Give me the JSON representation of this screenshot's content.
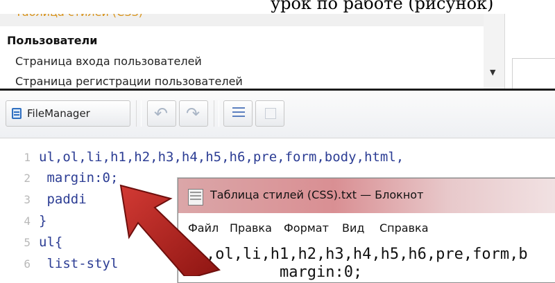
{
  "caption": {
    "text": "урок по работе (рисунок)"
  },
  "panel": {
    "items": [
      {
        "label": "Таблица стилей (CSS)"
      },
      {
        "label": "Пользователи"
      },
      {
        "label": "Страница входа пользователей"
      },
      {
        "label": "Страница регистрации пользователей"
      }
    ]
  },
  "toolbar": {
    "filemanager_label": "FileManager",
    "undo_icon": "undo-icon",
    "redo_icon": "redo-icon"
  },
  "editor": {
    "lines": [
      {
        "num": "1",
        "text": "ul,ol,li,h1,h2,h3,h4,h5,h6,pre,form,body,html,"
      },
      {
        "num": "2",
        "text": " margin:0;"
      },
      {
        "num": "3",
        "text": " paddi"
      },
      {
        "num": "4",
        "text": "}"
      },
      {
        "num": "5",
        "text": "ul{"
      },
      {
        "num": "6",
        "text": " list-styl"
      }
    ]
  },
  "notepad": {
    "title": "Таблица стилей (CSS).txt — Блокнот",
    "menu": [
      "Файл",
      "Правка",
      "Формат",
      "Вид",
      "Справка"
    ],
    "line1": ",ol,li,h1,h2,h3,h4,h5,h6,pre,form,b",
    "line2": "margin:0;"
  },
  "colors": {
    "arrow": "#b5201e",
    "selected_item_text": "#d8931a",
    "title_highlight": "#d98f93"
  }
}
